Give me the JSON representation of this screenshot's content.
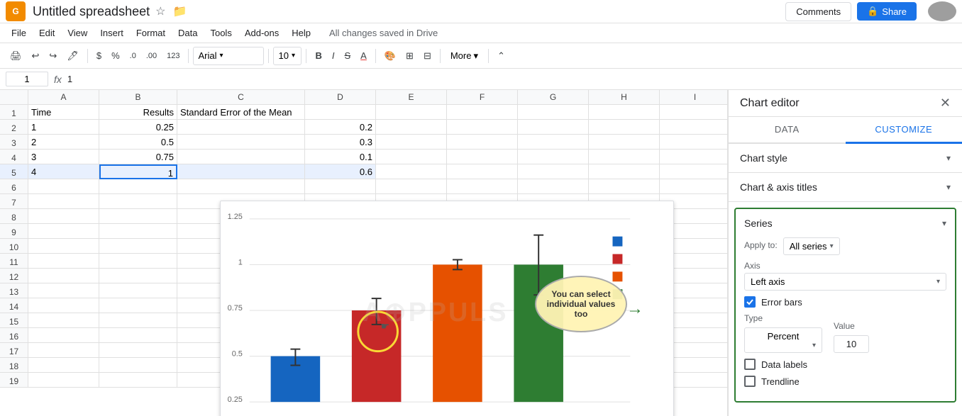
{
  "topbar": {
    "title": "Untitled spreadsheet",
    "logo_letter": "G",
    "comments_label": "Comments",
    "share_label": "Share",
    "share_icon": "🔒"
  },
  "menu": {
    "items": [
      "File",
      "Edit",
      "View",
      "Insert",
      "Format",
      "Data",
      "Tools",
      "Add-ons",
      "Help"
    ],
    "saved_msg": "All changes saved in Drive"
  },
  "toolbar": {
    "font": "Arial",
    "font_size": "10",
    "more_label": "More",
    "buttons": [
      "🖨",
      "↩",
      "↪",
      "🖊",
      "$",
      "%",
      ".0",
      ".00",
      "123"
    ]
  },
  "formula_bar": {
    "cell_ref": "1",
    "fx_symbol": "fx",
    "value": "1"
  },
  "columns": {
    "headers": [
      "A",
      "B",
      "C",
      "D",
      "E",
      "F",
      "G",
      "H",
      "I"
    ],
    "widths": [
      100,
      110,
      180,
      100,
      100,
      100,
      100,
      100,
      100
    ]
  },
  "spreadsheet": {
    "rows": [
      {
        "num": 1,
        "a": "Time",
        "b": "Results",
        "c": "Standard Error of the Mean",
        "d": "",
        "e": "",
        "f": "",
        "g": "",
        "h": "",
        "i": ""
      },
      {
        "num": 2,
        "a": "1",
        "b": "0.25",
        "c": "",
        "d": "0.2",
        "e": "",
        "f": "",
        "g": "",
        "h": "",
        "i": ""
      },
      {
        "num": 3,
        "a": "2",
        "b": "0.5",
        "c": "",
        "d": "0.3",
        "e": "",
        "f": "",
        "g": "",
        "h": "",
        "i": ""
      },
      {
        "num": 4,
        "a": "3",
        "b": "0.75",
        "c": "",
        "d": "0.1",
        "e": "",
        "f": "",
        "g": "",
        "h": "",
        "i": ""
      },
      {
        "num": 5,
        "a": "4",
        "b": "1",
        "c": "",
        "d": "0.6",
        "e": "",
        "f": "",
        "g": "",
        "h": "",
        "i": ""
      },
      {
        "num": 6,
        "a": "",
        "b": "",
        "c": "",
        "d": "",
        "e": "",
        "f": "",
        "g": "",
        "h": "",
        "i": ""
      },
      {
        "num": 7,
        "a": "",
        "b": "",
        "c": "",
        "d": "",
        "e": "",
        "f": "",
        "g": "",
        "h": "",
        "i": ""
      },
      {
        "num": 8,
        "a": "",
        "b": "",
        "c": "",
        "d": "",
        "e": "",
        "f": "",
        "g": "",
        "h": "",
        "i": ""
      },
      {
        "num": 9,
        "a": "",
        "b": "",
        "c": "",
        "d": "",
        "e": "",
        "f": "",
        "g": "",
        "h": "",
        "i": ""
      },
      {
        "num": 10,
        "a": "",
        "b": "",
        "c": "",
        "d": "",
        "e": "",
        "f": "",
        "g": "",
        "h": "",
        "i": ""
      },
      {
        "num": 11,
        "a": "",
        "b": "",
        "c": "",
        "d": "",
        "e": "",
        "f": "",
        "g": "",
        "h": "",
        "i": ""
      },
      {
        "num": 12,
        "a": "",
        "b": "",
        "c": "",
        "d": "",
        "e": "",
        "f": "",
        "g": "",
        "h": "",
        "i": ""
      },
      {
        "num": 13,
        "a": "",
        "b": "",
        "c": "",
        "d": "",
        "e": "",
        "f": "",
        "g": "",
        "h": "",
        "i": ""
      },
      {
        "num": 14,
        "a": "",
        "b": "",
        "c": "",
        "d": "",
        "e": "",
        "f": "",
        "g": "",
        "h": "",
        "i": ""
      },
      {
        "num": 15,
        "a": "",
        "b": "",
        "c": "",
        "d": "",
        "e": "",
        "f": "",
        "g": "",
        "h": "",
        "i": ""
      },
      {
        "num": 16,
        "a": "",
        "b": "",
        "c": "",
        "d": "",
        "e": "",
        "f": "",
        "g": "",
        "h": "",
        "i": ""
      },
      {
        "num": 17,
        "a": "",
        "b": "",
        "c": "",
        "d": "",
        "e": "",
        "f": "",
        "g": "",
        "h": "",
        "i": ""
      },
      {
        "num": 18,
        "a": "",
        "b": "",
        "c": "",
        "d": "",
        "e": "",
        "f": "",
        "g": "",
        "h": "",
        "i": ""
      },
      {
        "num": 19,
        "a": "",
        "b": "",
        "c": "",
        "d": "",
        "e": "",
        "f": "",
        "g": "",
        "h": "",
        "i": ""
      }
    ]
  },
  "chart_editor": {
    "title": "Chart editor",
    "close_icon": "✕",
    "tabs": [
      "DATA",
      "CUSTOMIZE"
    ],
    "active_tab": "CUSTOMIZE",
    "sections": [
      {
        "id": "chart_style",
        "label": "Chart style"
      },
      {
        "id": "chart_axis_titles",
        "label": "Chart & axis titles"
      },
      {
        "id": "series",
        "label": "Series"
      }
    ],
    "series": {
      "apply_to_label": "Apply to:",
      "apply_to_value": "All series",
      "axis_label": "Axis",
      "axis_value": "Left axis",
      "error_bars_label": "Error bars",
      "error_bars_checked": true,
      "type_label": "Type",
      "type_value": "Percent",
      "value_label": "Value",
      "value_value": "10",
      "data_labels_label": "Data labels",
      "data_labels_checked": false,
      "trendline_label": "Trendline",
      "trendline_checked": false
    }
  },
  "chart": {
    "watermark": "A⊙PPULS",
    "y_labels": [
      "1.25",
      "1",
      "0.75",
      "0.5",
      "0.25"
    ],
    "legend_colors": [
      "#1565c0",
      "#c62828",
      "#e65100",
      "#f9a825",
      "#2e7d32"
    ],
    "annotation": "You can select individual values too",
    "annotation_arrow": "→"
  }
}
